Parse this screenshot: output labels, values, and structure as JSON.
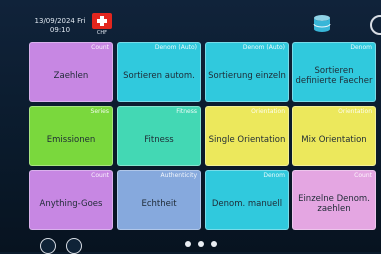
{
  "status": {
    "date_day": "13/09/2024 Fri",
    "time": "09:10",
    "country_code": "CHF"
  },
  "tiles": [
    {
      "category": "Count",
      "label": "Zaehlen"
    },
    {
      "category": "Denom (Auto)",
      "label": "Sortieren autom."
    },
    {
      "category": "Denom (Auto)",
      "label": "Sortierung einzeln"
    },
    {
      "category": "Denom",
      "label": "Sortieren definierte Faecher"
    },
    {
      "category": "Series",
      "label": "Emissionen"
    },
    {
      "category": "Fitness",
      "label": "Fitness"
    },
    {
      "category": "Orientation",
      "label": "Single Orientation"
    },
    {
      "category": "Orientation",
      "label": "Mix Orientation"
    },
    {
      "category": "Count",
      "label": "Anything-Goes"
    },
    {
      "category": "Authenticity",
      "label": "Echtheit"
    },
    {
      "category": "Denom",
      "label": "Denom. manuell"
    },
    {
      "category": "Count",
      "label": "Einzelne Denom. zaehlen"
    }
  ],
  "pagination": {
    "pages": 3,
    "current": 1
  },
  "icons": {
    "flag": "swiss-flag-icon",
    "database": "database-icon",
    "settings": "gear-icon",
    "list": "list-icon"
  }
}
